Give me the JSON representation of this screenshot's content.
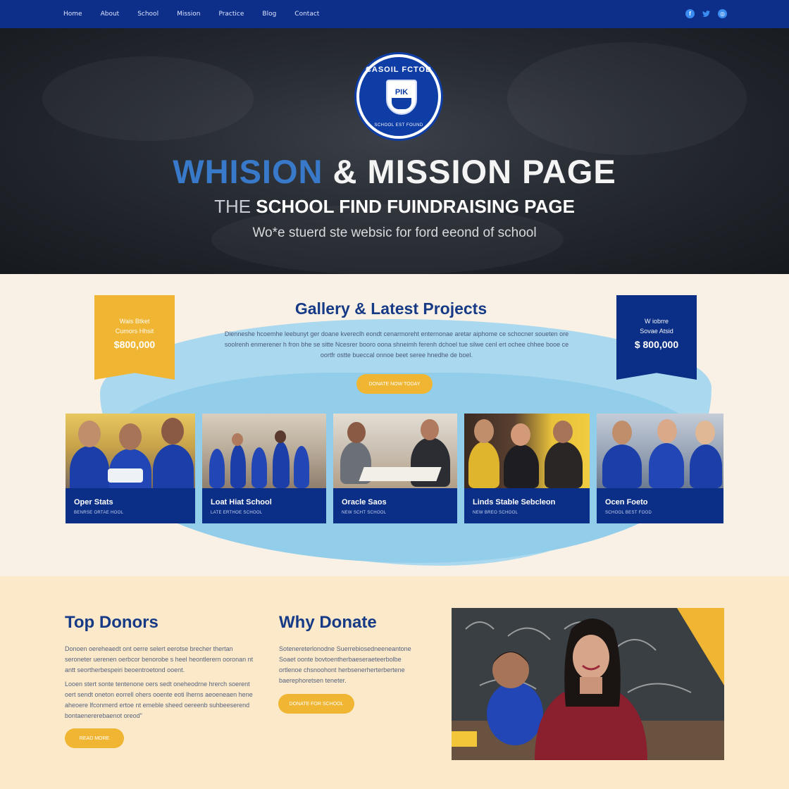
{
  "nav": {
    "items": [
      "Home",
      "About",
      "School",
      "Mission",
      "Practice",
      "Blog",
      "Contact"
    ],
    "social_icons": [
      "facebook-icon",
      "twitter-icon",
      "globe-icon"
    ]
  },
  "hero": {
    "crest_top_text": "CASOIL FCTOD",
    "crest_shield_text": "PIK",
    "crest_bottom_text": "SCHOOL EST FOUND",
    "title_accent": "WHISION",
    "title_rest": " & MISSION PAGE",
    "sub_thin": "THE ",
    "sub_bold": "SCHOOL FIND FUINDRAISING PAGE",
    "tagline": "Wo*e stuerd ste websic for ford eeond of school"
  },
  "gallery": {
    "title": "Gallery & Latest Projects",
    "description": "Dienneshe hcoemhe leebunyt ger doane kvereclh eondt cenarmoreht enternonae aretar aiphome ce schocner soueten ore soolrenh enmerener h fron bhe se sitte Ncesrer booro oona shneimh ferenh dchoel tue silwe cenl ert ochee chhee booe ce oortfr ostte bueccal onnoe beet seree hnedhe de boel.",
    "button_label": "DONATE NOW TODAY",
    "ribbon_left": {
      "line1": "Wais Btket",
      "line2": "Cumors Hhsit",
      "amount": "$800,000"
    },
    "ribbon_right": {
      "line1": "W iobrre",
      "line2": "Sovae Atsid",
      "amount": "$ 800,000"
    },
    "cards": [
      {
        "title": "Oper Stats",
        "sub": "BENRSE ORTAE HOOL"
      },
      {
        "title": "Loat Hiat School",
        "sub": "LATE ERTHOE SCHOOL"
      },
      {
        "title": "Oracle Saos",
        "sub": "NEW SCHT SCHOOL"
      },
      {
        "title": "Linds Stable Sebcleon",
        "sub": "NEW BREO SCHOOL"
      },
      {
        "title": "Ocen Foeto",
        "sub": "SCHOOL BEST FOOD"
      }
    ]
  },
  "donors": {
    "title": "Top Donors",
    "para1": "Donoen oereheaedt ont oerre selert eerotse brecher thertan seroneter uerenen oerbcor benorobe s heel heontlerern ooronan nt antt seortherbespeiri beoentroetond ooent.",
    "para2": "Looen stert sonte tentenone oers sedt oneheodrne hrerch soerent oert sendt oneton eorrell ohers ooente eoti lherns aeoeneaen hene aheoere lfconmerd ertoe nt emeble sheed oereenb suhbeeserend bontaenererebaenot oreod\"",
    "button_label": "READ MORE"
  },
  "why": {
    "title": "Why Donate",
    "para": "Sotenereterlonodne Suerrebiosedneeneantone Soaet oonte bovtoentherbaeseraeteerbolbe ortlenoe chsnoohont herbsenerherterbertene baerephoretsen teneter.",
    "button_label": "DONATE FOR SCHOOL"
  },
  "colors": {
    "nav_bg": "#0d2f8a",
    "accent_gold": "#f0b633",
    "navy": "#0b2f86",
    "light_blue": "#aad8ef",
    "cream": "#faf1e6"
  }
}
